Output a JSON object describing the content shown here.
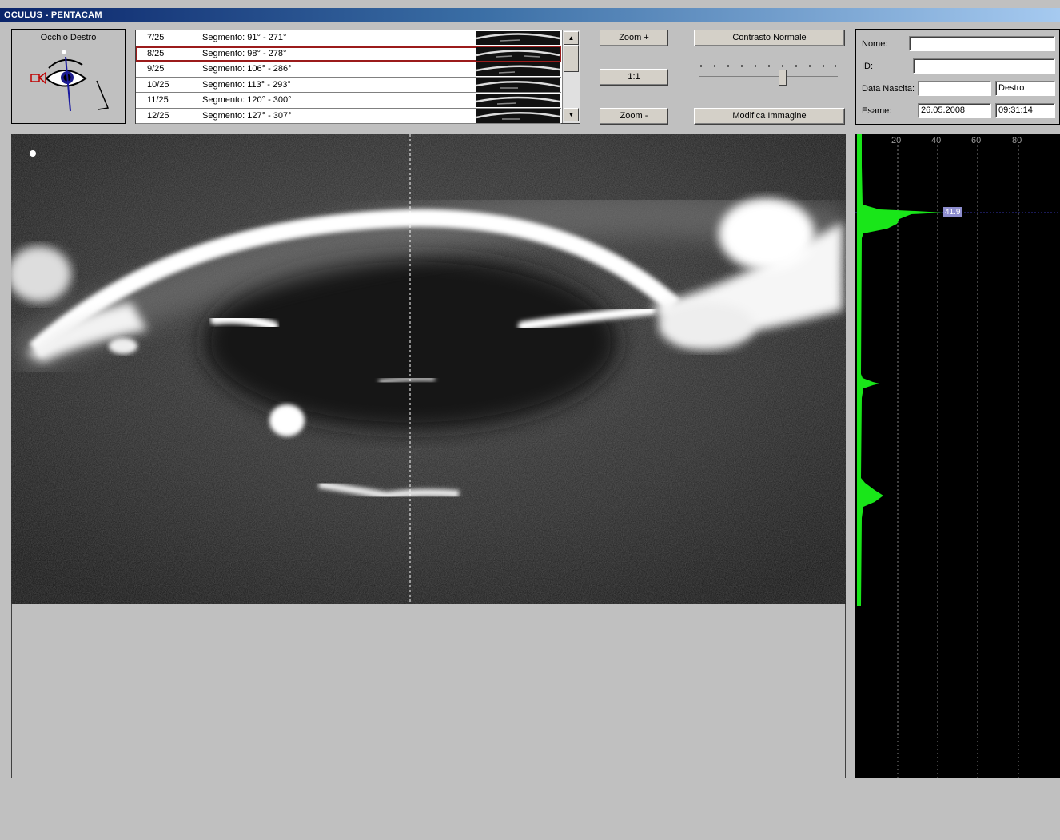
{
  "window": {
    "title": "OCULUS - PENTACAM"
  },
  "eye_panel": {
    "label": "Occhio Destro"
  },
  "segments": {
    "rows": [
      {
        "index": "7/25",
        "label": "Segmento: 91° - 271°",
        "selected": false
      },
      {
        "index": "8/25",
        "label": "Segmento: 98° - 278°",
        "selected": true
      },
      {
        "index": "9/25",
        "label": "Segmento: 106° - 286°",
        "selected": false
      },
      {
        "index": "10/25",
        "label": "Segmento: 113° - 293°",
        "selected": false
      },
      {
        "index": "11/25",
        "label": "Segmento: 120° - 300°",
        "selected": false
      },
      {
        "index": "12/25",
        "label": "Segmento: 127° - 307°",
        "selected": false
      }
    ]
  },
  "zoom": {
    "zoom_in": "Zoom +",
    "reset": "1:1",
    "zoom_out": "Zoom -"
  },
  "contrast": {
    "normal_label": "Contrasto Normale",
    "edit_label": "Modifica Immagine",
    "slider_value": 0.61
  },
  "patient": {
    "name_label": "Nome:",
    "name_value": "",
    "id_label": "ID:",
    "id_value": "",
    "dob_label": "Data Nascita:",
    "dob_value": "",
    "eye_value": "Destro",
    "exam_label": "Esame:",
    "exam_date": "26.05.2008",
    "exam_time": "09:31:14"
  },
  "histogram": {
    "ticks": [
      "20",
      "40",
      "60",
      "80"
    ],
    "peak_value": "41.9",
    "colors": {
      "profile": "#19e619",
      "marker": "#3333aa"
    }
  },
  "colors": {
    "selection": "#9b1b1b",
    "titlebar": "#0a246a"
  }
}
